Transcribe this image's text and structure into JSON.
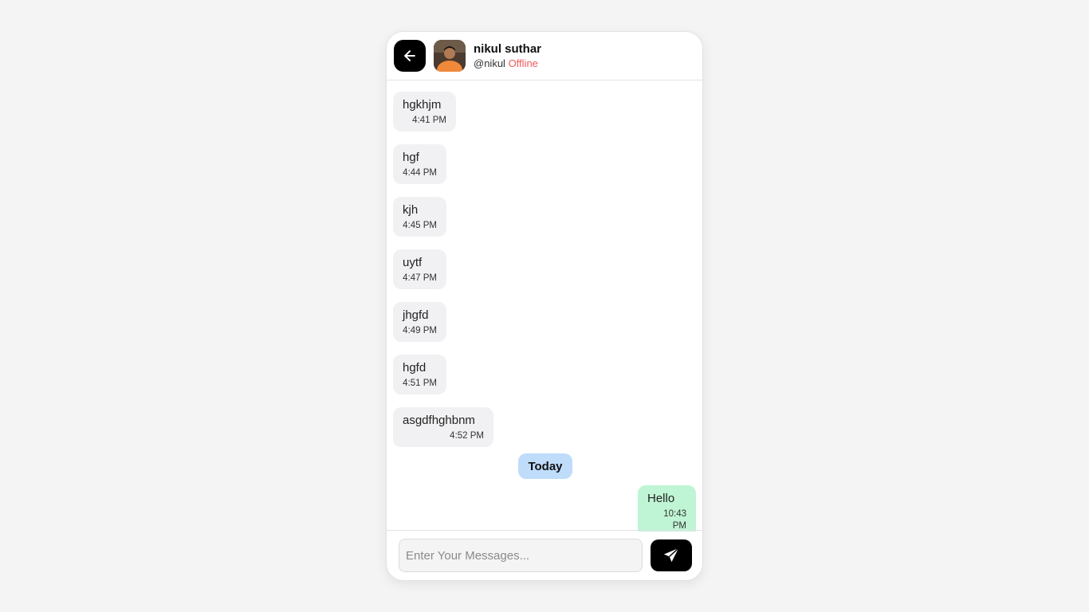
{
  "header": {
    "user_name": "nikul suthar",
    "username": "@nikul",
    "status": "Offline"
  },
  "icons": {
    "back": "arrow-left-icon",
    "send": "paper-plane-icon"
  },
  "colors": {
    "offline": "#ef5b5b",
    "incoming_bubble": "#f1f1f3",
    "outgoing_bubble": "#bff5d4",
    "date_badge": "#bfdcfb"
  },
  "messages": [
    {
      "text": "hgkhjm",
      "time": "4:41 PM",
      "direction": "incoming"
    },
    {
      "text": "hgf",
      "time": "4:44 PM",
      "direction": "incoming"
    },
    {
      "text": "kjh",
      "time": "4:45 PM",
      "direction": "incoming"
    },
    {
      "text": "uytf",
      "time": "4:47 PM",
      "direction": "incoming"
    },
    {
      "text": "jhgfd",
      "time": "4:49 PM",
      "direction": "incoming"
    },
    {
      "text": "hgfd",
      "time": "4:51 PM",
      "direction": "incoming"
    },
    {
      "text": "asgdfhghbnm",
      "time": "4:52 PM",
      "direction": "incoming"
    }
  ],
  "divider": "Today",
  "today_messages": [
    {
      "text": "Hello",
      "time": "10:43 PM",
      "direction": "outgoing"
    }
  ],
  "composer": {
    "placeholder": "Enter Your Messages...",
    "value": ""
  }
}
